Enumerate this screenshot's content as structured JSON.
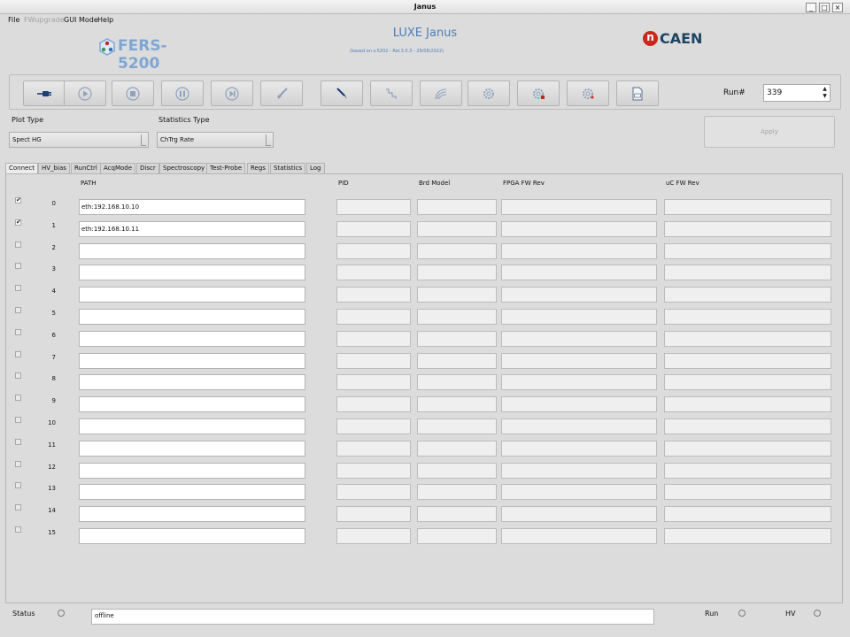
{
  "window": {
    "title": "Janus"
  },
  "window_buttons": [
    "_",
    "□",
    "×"
  ],
  "menu": [
    {
      "label": "File",
      "enabled": true
    },
    {
      "label": "FWupgrade",
      "enabled": false
    },
    {
      "label": "GUI Mode",
      "enabled": true
    },
    {
      "label": "Help",
      "enabled": true
    }
  ],
  "header": {
    "fers_logo_text": "FERS-5200",
    "app_title": "LUXE Janus",
    "app_subtitle": "(based on v.5202 - Rel.3.0.3 - 29/08/2022)",
    "caen_logo_text": "CAEN",
    "caen_n": "n"
  },
  "toolbar": {
    "buttons": [
      {
        "icon": "connect-plug-icon"
      },
      {
        "icon": "play-icon"
      },
      {
        "icon": "stop-icon"
      },
      {
        "icon": "pause-icon"
      },
      {
        "icon": "step-icon"
      },
      {
        "icon": "clear-brush-icon"
      },
      {
        "icon": "probe-icon"
      },
      {
        "icon": "staircase-icon"
      },
      {
        "icon": "waveform-icon"
      },
      {
        "icon": "gear-config-icon"
      },
      {
        "icon": "gear-red-icon"
      },
      {
        "icon": "gear-settings-icon"
      },
      {
        "icon": "csv-file-icon"
      }
    ],
    "run_label": "Run#",
    "run_number": "339"
  },
  "plot_type": {
    "label": "Plot Type",
    "value": "Spect HG"
  },
  "statistics_type": {
    "label": "Statistics Type",
    "value": "ChTrg Rate"
  },
  "apply_label": "Apply",
  "tabs": [
    "Connect",
    "HV_bias",
    "RunCtrl",
    "AcqMode",
    "Discr",
    "Spectroscopy",
    "Test-Probe",
    "Regs",
    "Statistics",
    "Log"
  ],
  "active_tab": "Connect",
  "connect": {
    "headers": {
      "path": "PATH",
      "pid": "PID",
      "brd_model": "Brd Model",
      "fpga_fw": "FPGA FW Rev",
      "uc_fw": "uC FW Rev"
    },
    "rows": [
      {
        "index": "0",
        "enabled": true,
        "path": "eth:192.168.10.10"
      },
      {
        "index": "1",
        "enabled": true,
        "path": "eth:192.168.10.11"
      },
      {
        "index": "2",
        "enabled": false,
        "path": ""
      },
      {
        "index": "3",
        "enabled": false,
        "path": ""
      },
      {
        "index": "4",
        "enabled": false,
        "path": ""
      },
      {
        "index": "5",
        "enabled": false,
        "path": ""
      },
      {
        "index": "6",
        "enabled": false,
        "path": ""
      },
      {
        "index": "7",
        "enabled": false,
        "path": ""
      },
      {
        "index": "8",
        "enabled": false,
        "path": ""
      },
      {
        "index": "9",
        "enabled": false,
        "path": ""
      },
      {
        "index": "10",
        "enabled": false,
        "path": ""
      },
      {
        "index": "11",
        "enabled": false,
        "path": ""
      },
      {
        "index": "12",
        "enabled": false,
        "path": ""
      },
      {
        "index": "13",
        "enabled": false,
        "path": ""
      },
      {
        "index": "14",
        "enabled": false,
        "path": ""
      },
      {
        "index": "15",
        "enabled": false,
        "path": ""
      }
    ]
  },
  "status_bar": {
    "status_label": "Status",
    "status_value": "offline",
    "run_label": "Run",
    "hv_label": "HV"
  },
  "colors": {
    "logo_blue": "#7ea6d4",
    "title_blue": "#4f7fb8",
    "caen_red": "#c8281e",
    "caen_navy": "#1d4560"
  }
}
